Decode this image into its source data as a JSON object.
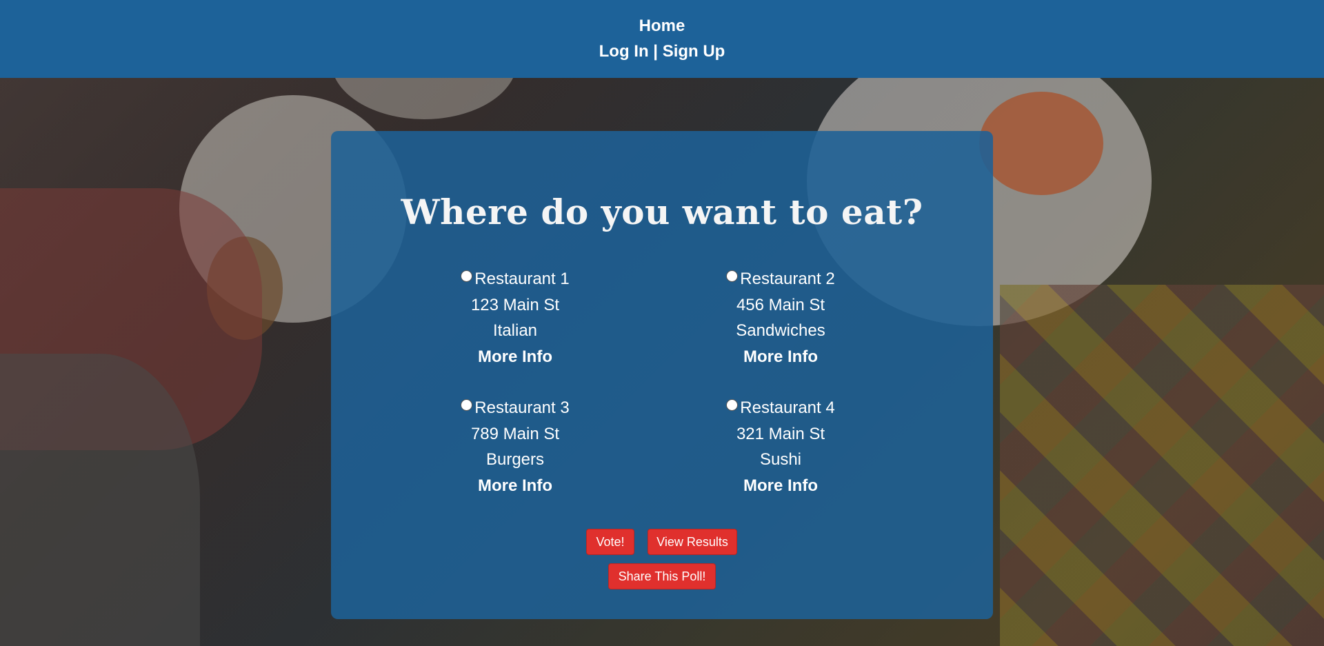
{
  "nav": {
    "home": "Home",
    "login": "Log In",
    "separator": "|",
    "signup": "Sign Up"
  },
  "poll": {
    "title": "Where do you want to eat?",
    "options": [
      {
        "name": "Restaurant 1",
        "address": "123 Main St",
        "cuisine": "Italian",
        "more_info": "More Info"
      },
      {
        "name": "Restaurant 2",
        "address": "456 Main St",
        "cuisine": "Sandwiches",
        "more_info": "More Info"
      },
      {
        "name": "Restaurant 3",
        "address": "789 Main St",
        "cuisine": "Burgers",
        "more_info": "More Info"
      },
      {
        "name": "Restaurant 4",
        "address": "321 Main St",
        "cuisine": "Sushi",
        "more_info": "More Info"
      }
    ],
    "buttons": {
      "vote": "Vote!",
      "view_results": "View Results",
      "share": "Share This Poll!"
    }
  },
  "colors": {
    "navbar": "#1d6299",
    "card": "#1e6196",
    "button": "#e0302d",
    "text": "#ffffff"
  }
}
